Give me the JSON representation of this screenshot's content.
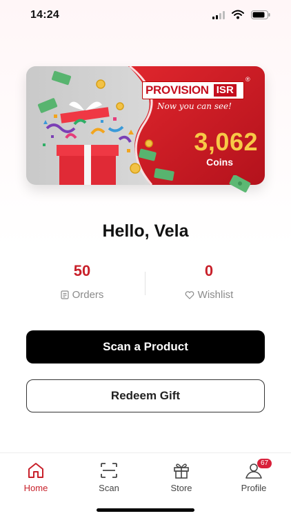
{
  "status_bar": {
    "time": "14:24"
  },
  "rewards_card": {
    "brand_name": "PROVISION",
    "brand_suffix": "ISR",
    "brand_mark": "®",
    "tagline": "Now you can see!",
    "coins_value": "3,062",
    "coins_label": "Coins",
    "colors": {
      "accent": "#c8202a",
      "coin_gold": "#f7c947",
      "card_grey": "#d8d8d8"
    }
  },
  "greeting": "Hello, Vela",
  "stats": {
    "orders": {
      "value": "50",
      "label": "Orders",
      "icon": "orders-icon"
    },
    "wishlist": {
      "value": "0",
      "label": "Wishlist",
      "icon": "heart-icon"
    }
  },
  "actions": {
    "scan_product": "Scan a Product",
    "redeem_gift": "Redeem Gift"
  },
  "bottom_nav": {
    "items": [
      {
        "label": "Home",
        "icon": "home-icon",
        "active": true
      },
      {
        "label": "Scan",
        "icon": "scan-icon",
        "active": false
      },
      {
        "label": "Store",
        "icon": "gift-icon",
        "active": false
      },
      {
        "label": "Profile",
        "icon": "profile-icon",
        "active": false,
        "badge": "67"
      }
    ]
  }
}
